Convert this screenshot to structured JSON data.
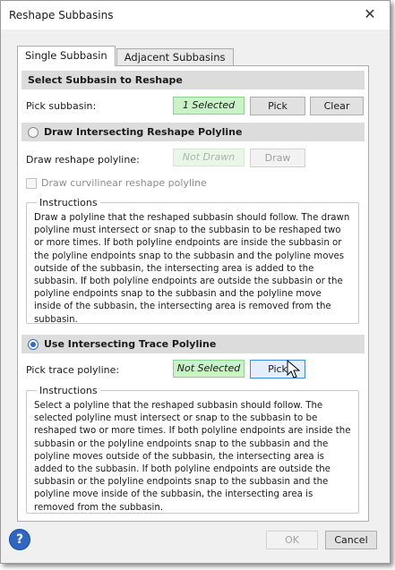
{
  "window": {
    "title": "Reshape Subbasins",
    "close_glyph": "✕"
  },
  "tabs": [
    {
      "label": "Single Subbasin",
      "active": true
    },
    {
      "label": "Adjacent Subbasins",
      "active": false
    }
  ],
  "select_section": {
    "header": "Select Subbasin to Reshape",
    "pick_label": "Pick subbasin:",
    "status": "1 Selected",
    "pick_button": "Pick",
    "clear_button": "Clear"
  },
  "draw_section": {
    "header": "Draw Intersecting Reshape Polyline",
    "selected": false,
    "draw_label": "Draw reshape polyline:",
    "status": "Not Drawn",
    "draw_button": "Draw",
    "curvilinear_label": "Draw curvilinear reshape polyline",
    "curvilinear_checked": false,
    "instructions_legend": "Instructions",
    "instructions_text": "Draw a polyline that the reshaped subbasin should follow. The drawn polyline must intersect or snap to the subbasin to be reshaped two or more times. If both polyline endpoints are inside the subbasin or the polyline endpoints snap to the subbasin and the polyline moves outside of the subbasin, the intersecting area is added to the subbasin. If both polyline endpoints are outside the subbasin or the polyline endpoints snap to the subbasin and the polyline move inside of the subbasin, the intersecting area is removed from the subbasin."
  },
  "trace_section": {
    "header": "Use Intersecting Trace Polyline",
    "selected": true,
    "pick_label": "Pick trace polyline:",
    "status": "Not Selected",
    "pick_button": "Pick",
    "instructions_legend": "Instructions",
    "instructions_text": "Select a polyline that the reshaped subbasin should follow. The selected polyline must intersect or snap to the subbasin to be reshaped two or more times. If both polyline endpoints are inside the subbasin or the polyline endpoints snap to the subbasin and the polyline moves outside of the subbasin, the intersecting area is added to the subbasin. If both polyline endpoints are outside the subbasin or the polyline endpoints snap to the subbasin and the polyline move inside of the subbasin, the intersecting area is removed from the subbasin."
  },
  "footer": {
    "help_glyph": "?",
    "ok_button": "OK",
    "cancel_button": "Cancel"
  },
  "icons": {
    "help": "help-icon",
    "close": "close-icon",
    "cursor": "mouse-pointer-icon"
  }
}
